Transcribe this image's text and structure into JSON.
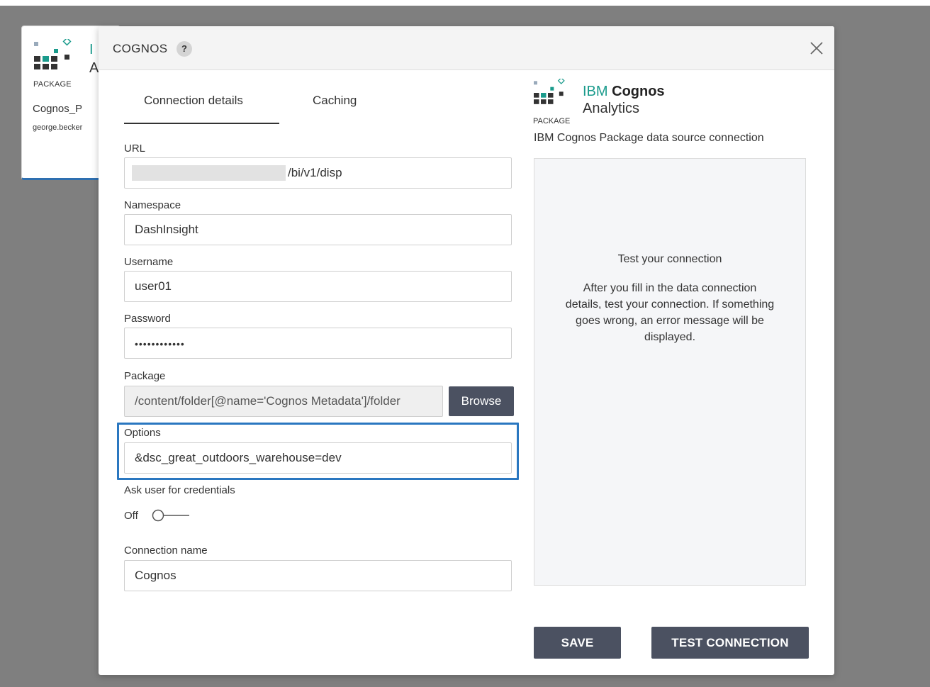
{
  "background_card": {
    "package_label": "PACKAGE",
    "title_fragment_1": "I",
    "title_fragment_2": "A",
    "name": "Cognos_P",
    "owner": "george.becker"
  },
  "dialog": {
    "title": "COGNOS",
    "help_symbol": "?",
    "tabs": [
      {
        "label": "Connection details",
        "active": true
      },
      {
        "label": "Caching",
        "active": false
      }
    ],
    "form": {
      "url": {
        "label": "URL",
        "value": "/bi/v1/disp"
      },
      "namespace": {
        "label": "Namespace",
        "value": "DashInsight"
      },
      "username": {
        "label": "Username",
        "value": "user01"
      },
      "password": {
        "label": "Password",
        "value": "••••••••••••"
      },
      "package": {
        "label": "Package",
        "value": "/content/folder[@name='Cognos Metadata']/folder",
        "browse_label": "Browse"
      },
      "options": {
        "label": "Options",
        "value": "&dsc_great_outdoors_warehouse=dev"
      },
      "ask_credentials": {
        "label": "Ask user for credentials",
        "state_label": "Off",
        "enabled": false
      },
      "connection_name": {
        "label": "Connection name",
        "value": "Cognos"
      }
    },
    "brand": {
      "package_label": "PACKAGE",
      "ibm": "IBM",
      "cognos": "Cognos",
      "analytics": "Analytics",
      "description": "IBM Cognos Package data source connection"
    },
    "test_panel": {
      "title": "Test your connection",
      "message": "After you fill in the data connection details, test your connection. If something goes wrong, an error message will be displayed."
    },
    "buttons": {
      "save": "SAVE",
      "test_connection": "TEST CONNECTION"
    }
  },
  "colors": {
    "overlay": "#7f7f7f",
    "brand_teal": "#1a9b8c",
    "button_dark": "#4b5161",
    "highlight_blue": "#2a77c0"
  }
}
